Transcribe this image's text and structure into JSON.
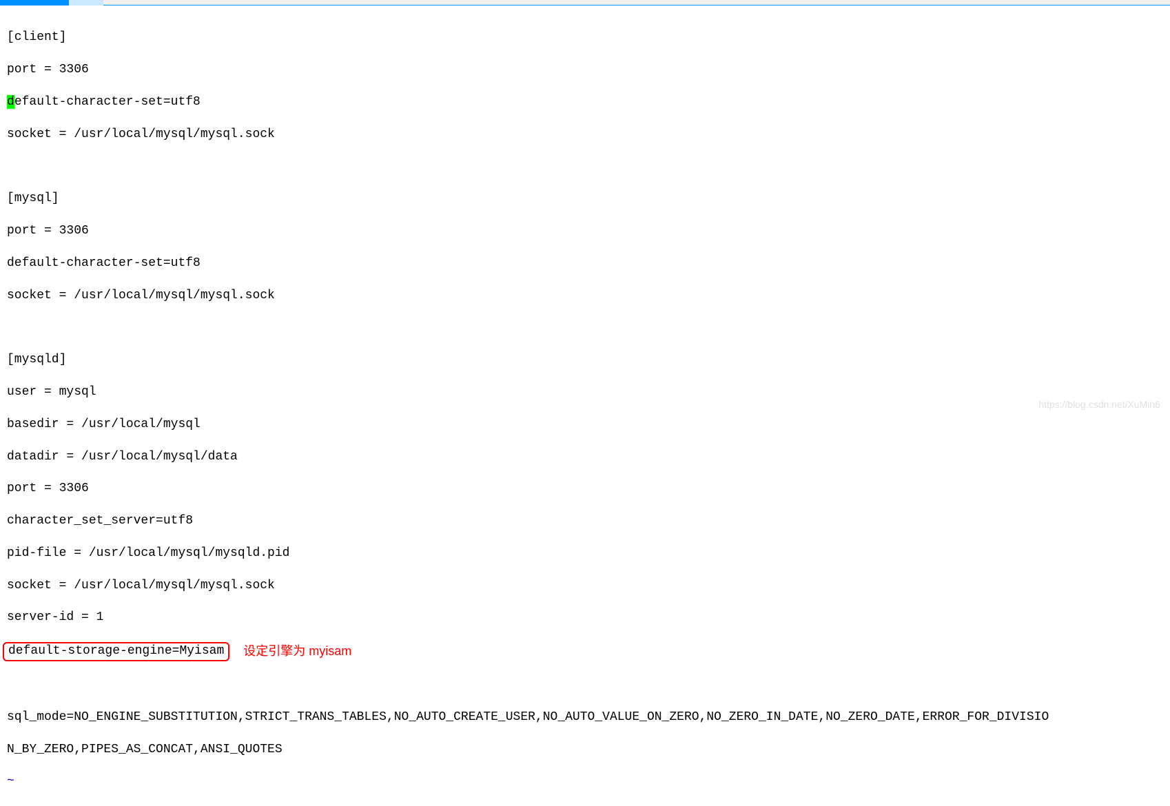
{
  "config": {
    "client": {
      "header": "[client]",
      "port": "port = 3306",
      "default_charset_prefix": "d",
      "default_charset_rest": "efault-character-set=utf8",
      "socket": "socket = /usr/local/mysql/mysql.sock"
    },
    "mysql": {
      "header": "[mysql]",
      "port": "port = 3306",
      "default_charset": "default-character-set=utf8",
      "socket": "socket = /usr/local/mysql/mysql.sock"
    },
    "mysqld": {
      "header": "[mysqld]",
      "user": "user = mysql",
      "basedir": "basedir = /usr/local/mysql",
      "datadir": "datadir = /usr/local/mysql/data",
      "port": "port = 3306",
      "charset_server": "character_set_server=utf8",
      "pid_file": "pid-file = /usr/local/mysql/mysqld.pid",
      "socket": "socket = /usr/local/mysql/mysql.sock",
      "server_id": "server-id = 1",
      "default_storage_engine": "default-storage-engine=Myisam",
      "sql_mode_line1": "sql_mode=NO_ENGINE_SUBSTITUTION,STRICT_TRANS_TABLES,NO_AUTO_CREATE_USER,NO_AUTO_VALUE_ON_ZERO,NO_ZERO_IN_DATE,NO_ZERO_DATE,ERROR_FOR_DIVISIO",
      "sql_mode_line2": "N_BY_ZERO,PIPES_AS_CONCAT,ANSI_QUOTES"
    }
  },
  "annotation": {
    "red_text": "设定引擎为 myisam"
  },
  "eof_marker": "~",
  "watermark": "https://blog.csdn.net/XuMin6"
}
